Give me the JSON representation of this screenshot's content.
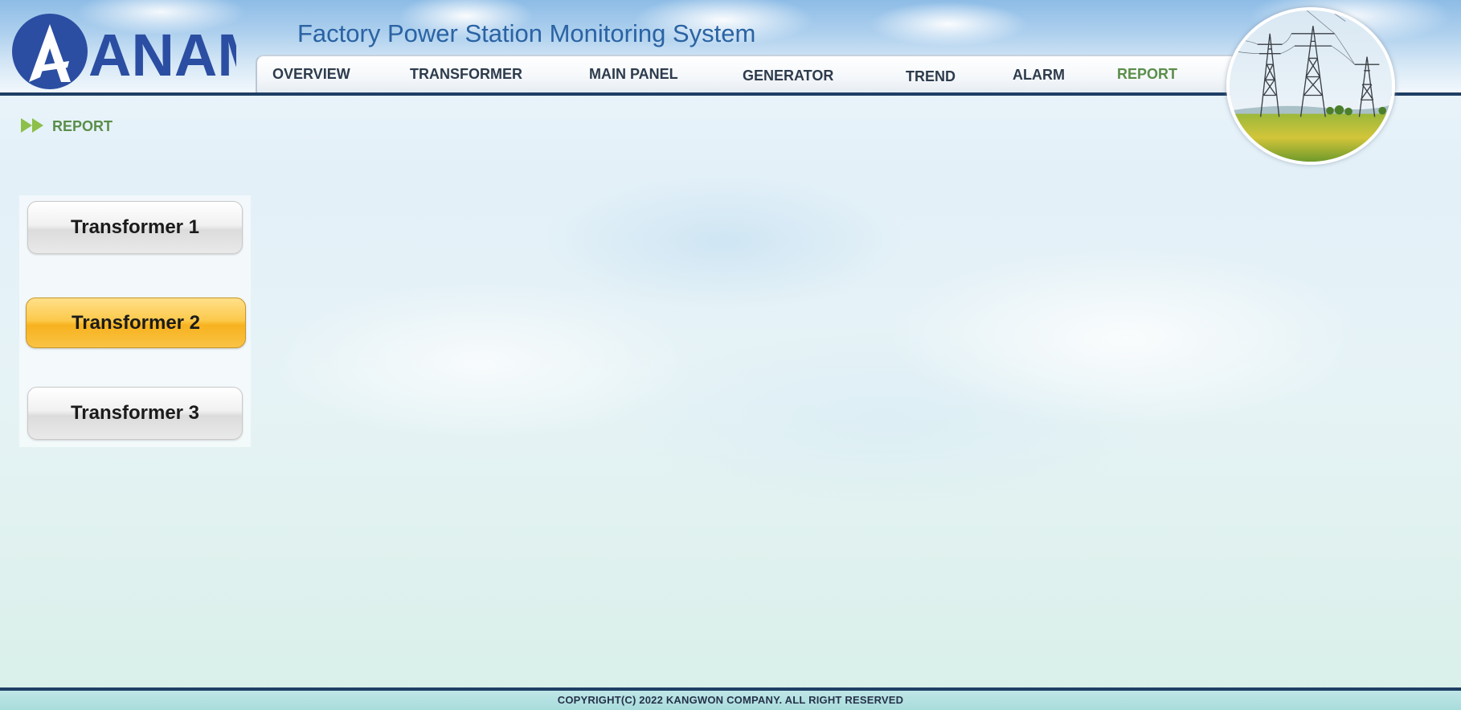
{
  "header": {
    "logo_text": "ANAM",
    "system_title": "Factory Power Station Monitoring System"
  },
  "nav": {
    "items": [
      {
        "label": "OVERVIEW",
        "active": false
      },
      {
        "label": "TRANSFORMER",
        "active": false
      },
      {
        "label": "MAIN PANEL",
        "active": false
      },
      {
        "label": "GENERATOR",
        "active": false
      },
      {
        "label": "TREND",
        "active": false
      },
      {
        "label": "ALARM",
        "active": false
      },
      {
        "label": "REPORT",
        "active": true
      }
    ]
  },
  "section": {
    "title": "REPORT",
    "icon": "double-arrow-icon"
  },
  "transformer_buttons": [
    {
      "label": "Transformer 1",
      "selected": false
    },
    {
      "label": "Transformer 2",
      "selected": true
    },
    {
      "label": "Transformer 3",
      "selected": false
    }
  ],
  "footer": {
    "copyright": "COPYRIGHT(C) 2022 KANGWON COMPANY. ALL RIGHT RESERVED"
  },
  "colors": {
    "title_blue": "#2a63a3",
    "active_green": "#5a8e4a",
    "selected_yellow": "#f7b21f",
    "header_line": "#1e3e64"
  }
}
